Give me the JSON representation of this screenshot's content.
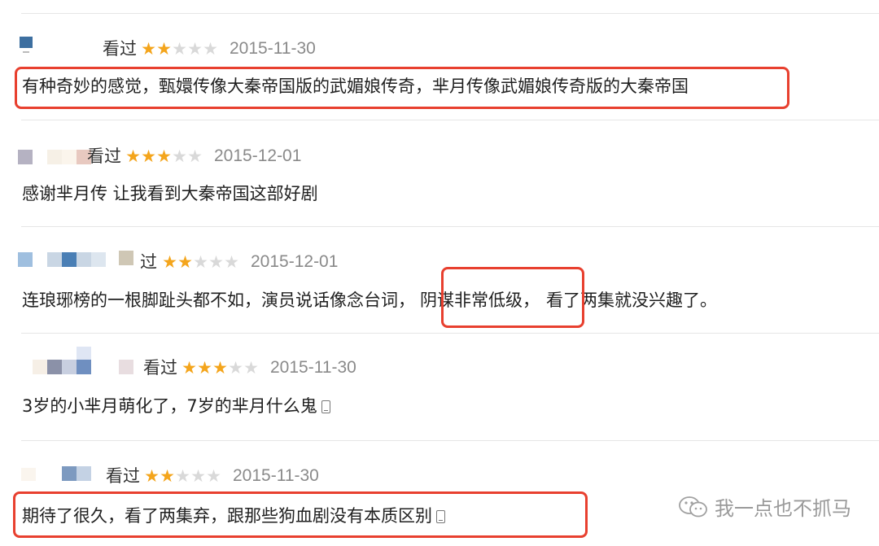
{
  "reviews": [
    {
      "meta": "看过",
      "rating": 2,
      "max_rating": 5,
      "date": "2015-11-30",
      "comment": "有种奇妙的感觉，甄嬛传像大秦帝国版的武媚娘传奇，芈月传像武媚娘传奇版的大秦帝国",
      "highlight": "whole-comment",
      "mobile": false
    },
    {
      "meta": "看过",
      "rating": 3,
      "max_rating": 5,
      "date": "2015-12-01",
      "comment": "感谢芈月传 让我看到大秦帝国这部好剧",
      "mobile": false
    },
    {
      "meta": "过",
      "rating": 2,
      "max_rating": 5,
      "date": "2015-12-01",
      "comment_before": "连琅琊榜的一根脚趾头都不如，演员说话像念台词，",
      "comment_highlight": "阴谋非常低级，",
      "comment_after": "看了两集就没兴趣了。",
      "mobile": false
    },
    {
      "meta": "看过",
      "rating": 3,
      "max_rating": 5,
      "date": "2015-11-30",
      "comment": "3岁的小芈月萌化了，7岁的芈月什么鬼",
      "mobile": true
    },
    {
      "meta": "看过",
      "rating": 2,
      "max_rating": 5,
      "date": "2015-11-30",
      "comment": "期待了很久，看了两集弃，跟那些狗血剧没有本质区别",
      "highlight": "whole-comment",
      "mobile": true
    }
  ],
  "watermark": {
    "text": "我一点也不抓马",
    "icon": "wechat-icon"
  },
  "colors": {
    "star_on": "#f4a51c",
    "star_off": "#d9d9d9",
    "highlight": "#e8402f",
    "date": "#8a8a8a"
  }
}
